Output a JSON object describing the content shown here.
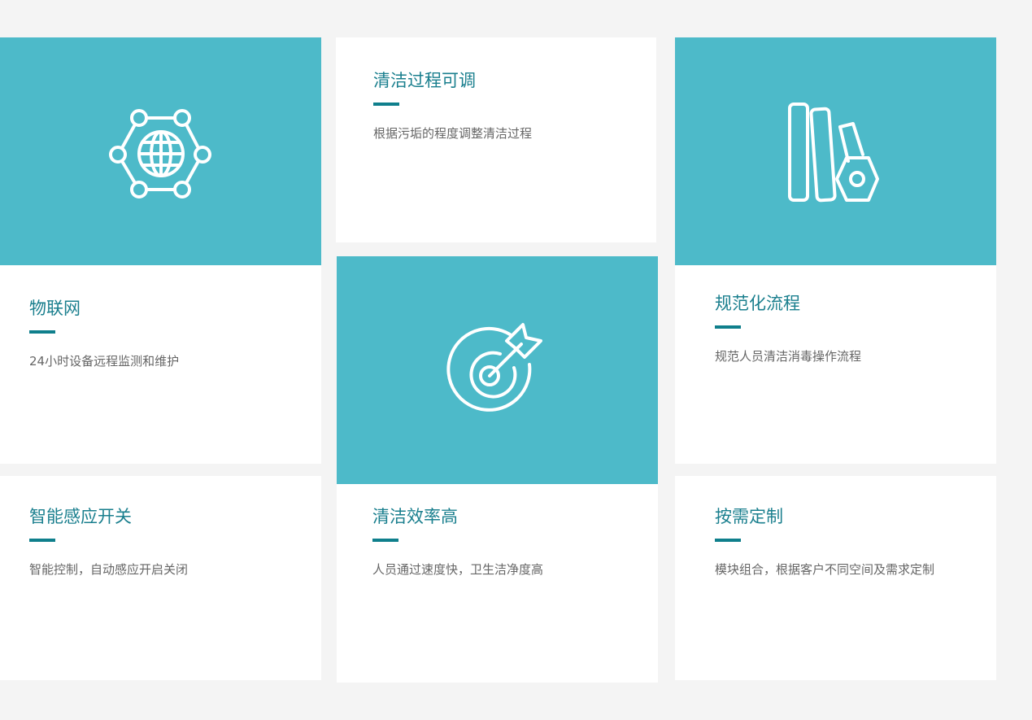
{
  "colors": {
    "background": "#f4f4f4",
    "tile": "#4dbac9",
    "card": "#ffffff",
    "title": "#1a7f8e",
    "accent_bar": "#0f7f8c",
    "description": "#666666"
  },
  "icon_tiles": [
    {
      "icon": "iot-network-icon"
    },
    {
      "icon": "target-icon"
    },
    {
      "icon": "books-standard-icon"
    }
  ],
  "features": [
    {
      "title": "清洁过程可调",
      "description": "根据污垢的程度调整清洁过程"
    },
    {
      "title": "物联网",
      "description": "24小时设备远程监测和维护"
    },
    {
      "title": "规范化流程",
      "description": "规范人员清洁消毒操作流程"
    },
    {
      "title": "智能感应开关",
      "description": "智能控制，自动感应开启关闭"
    },
    {
      "title": "清洁效率高",
      "description": "人员通过速度快，卫生洁净度高"
    },
    {
      "title": "按需定制",
      "description": "模块组合，根据客户不同空间及需求定制"
    }
  ]
}
